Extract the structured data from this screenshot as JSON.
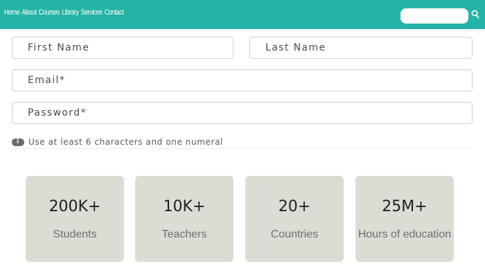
{
  "nav": {
    "links": [
      "Home",
      "About",
      "Courses",
      "Library",
      "Services",
      "Contact"
    ],
    "search": {
      "placeholder": "",
      "value": "",
      "icon": "search-icon"
    },
    "background_color": "#25b3a5"
  },
  "form": {
    "first_name": {
      "placeholder": "First Name"
    },
    "last_name": {
      "placeholder": "Last Name"
    },
    "email": {
      "placeholder": "Email*"
    },
    "password": {
      "placeholder": "Password*"
    },
    "hint": {
      "icon": "info-icon",
      "text": "Use at least 6 characters and one numeral"
    }
  },
  "stats": [
    {
      "value": "200K+",
      "label": "Students"
    },
    {
      "value": "10K+",
      "label": "Teachers"
    },
    {
      "value": "20+",
      "label": "Countries"
    },
    {
      "value": "25M+",
      "label": "Hours of education"
    }
  ],
  "colors": {
    "card_background": "#dcdcd4",
    "field_border": "#d2d2d2"
  }
}
